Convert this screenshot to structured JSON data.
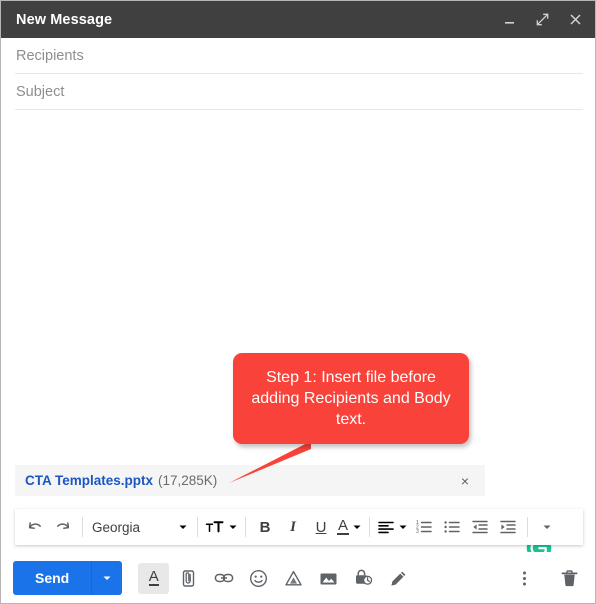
{
  "window": {
    "title": "New Message",
    "titlebar_bg": "#404040",
    "actions": [
      {
        "name": "minimize-button",
        "icon": "minimize-icon"
      },
      {
        "name": "expand-button",
        "icon": "expand-icon"
      },
      {
        "name": "close-button",
        "icon": "close-icon"
      }
    ]
  },
  "fields": {
    "recipients": {
      "label": "Recipients",
      "value": ""
    },
    "subject": {
      "label": "Subject",
      "value": ""
    }
  },
  "body": {
    "value": ""
  },
  "grammarly": {
    "label": "G",
    "color": "#18c495"
  },
  "callout": {
    "text": "Step 1: Insert file before adding Recipients and Body text.",
    "color": "#f9423a",
    "text_color": "#ffffff"
  },
  "attachment": {
    "filename": "CTA Templates.pptx",
    "size": "(17,285K)",
    "remove_label": "×",
    "name_color": "#1a56c4"
  },
  "format_toolbar": {
    "undo": "undo-icon",
    "redo": "redo-icon",
    "font_name": "Georgia",
    "text_size": "text-size-icon",
    "bold": "B",
    "italic": "I",
    "underline": "U",
    "text_color": "A",
    "align": "align-left-icon",
    "numbered_list": "numbered-list-icon",
    "bulleted_list": "bulleted-list-icon",
    "indent_less": "indent-less-icon",
    "indent_more": "indent-more-icon",
    "more": "more-formatting-icon"
  },
  "bottom_bar": {
    "send_label": "Send",
    "send_color": "#1a73e8",
    "send_options": "send-options-icon",
    "icons": [
      {
        "name": "formatting-options-icon",
        "label": "A",
        "active": true
      },
      {
        "name": "attach-file-icon",
        "label": ""
      },
      {
        "name": "insert-link-icon",
        "label": ""
      },
      {
        "name": "insert-emoji-icon",
        "label": ""
      },
      {
        "name": "insert-drive-file-icon",
        "label": ""
      },
      {
        "name": "insert-photo-icon",
        "label": ""
      },
      {
        "name": "confidential-mode-icon",
        "label": ""
      },
      {
        "name": "insert-signature-icon",
        "label": ""
      }
    ],
    "more_options": "more-options-icon",
    "discard": "discard-draft-icon"
  }
}
